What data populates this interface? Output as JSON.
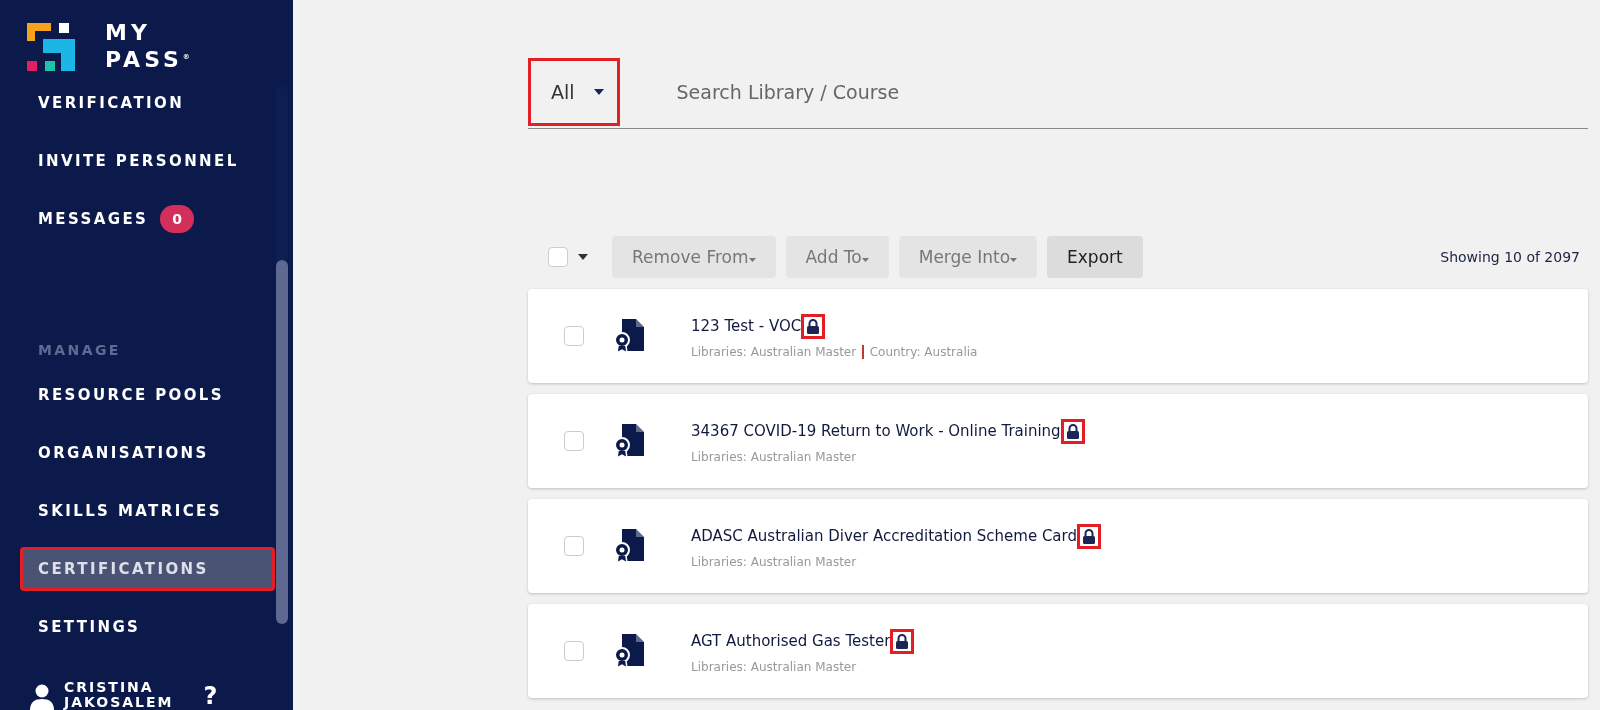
{
  "logo": {
    "line_1": "MY",
    "line_2": "PASS",
    "mark": "®"
  },
  "sidebar": {
    "items": [
      {
        "label": "VERIFICATION",
        "selected": false,
        "highlighted": false
      },
      {
        "label": "INVITE PERSONNEL",
        "selected": false,
        "highlighted": false
      },
      {
        "label": "MESSAGES",
        "badge": "0",
        "selected": false,
        "highlighted": false
      }
    ],
    "section_title": "MANAGE",
    "manage_items": [
      {
        "label": "RESOURCE POOLS",
        "selected": false,
        "highlighted": false
      },
      {
        "label": "ORGANISATIONS",
        "selected": false,
        "highlighted": false
      },
      {
        "label": "SKILLS MATRICES",
        "selected": false,
        "highlighted": false
      },
      {
        "label": "CERTIFICATIONS",
        "selected": true,
        "highlighted": true
      },
      {
        "label": "SETTINGS",
        "selected": false,
        "highlighted": false
      }
    ],
    "user": {
      "first_name": "CRISTINA",
      "last_name": "JAKOSALEM",
      "help": "?"
    }
  },
  "filter": {
    "value": "All",
    "highlighted": true
  },
  "search": {
    "placeholder": "Search Library / Course"
  },
  "toolbar": {
    "select_all": {
      "checked": false
    },
    "buttons": [
      {
        "label": "Remove From",
        "dropdown": true,
        "disabled": true
      },
      {
        "label": "Add To",
        "dropdown": true,
        "disabled": true
      },
      {
        "label": "Merge Into",
        "dropdown": true,
        "disabled": true
      },
      {
        "label": "Export",
        "dropdown": false,
        "disabled": false
      }
    ],
    "count": "Showing 10 of 2097"
  },
  "rows": [
    {
      "title": "123 Test - VOC",
      "checked": false,
      "locked": true,
      "lock_highlighted": true,
      "meta": [
        "Libraries: Australian Master",
        "Country: Australia"
      ]
    },
    {
      "title": "34367 COVID-19 Return to Work - Online Training",
      "checked": false,
      "locked": true,
      "lock_highlighted": true,
      "meta": [
        "Libraries: Australian Master"
      ]
    },
    {
      "title": "ADASC Australian Diver Accreditation Scheme Card",
      "checked": false,
      "locked": true,
      "lock_highlighted": true,
      "meta": [
        "Libraries: Australian Master"
      ]
    },
    {
      "title": "AGT Authorised Gas Tester",
      "checked": false,
      "locked": true,
      "lock_highlighted": true,
      "meta": [
        "Libraries: Australian Master"
      ]
    }
  ]
}
